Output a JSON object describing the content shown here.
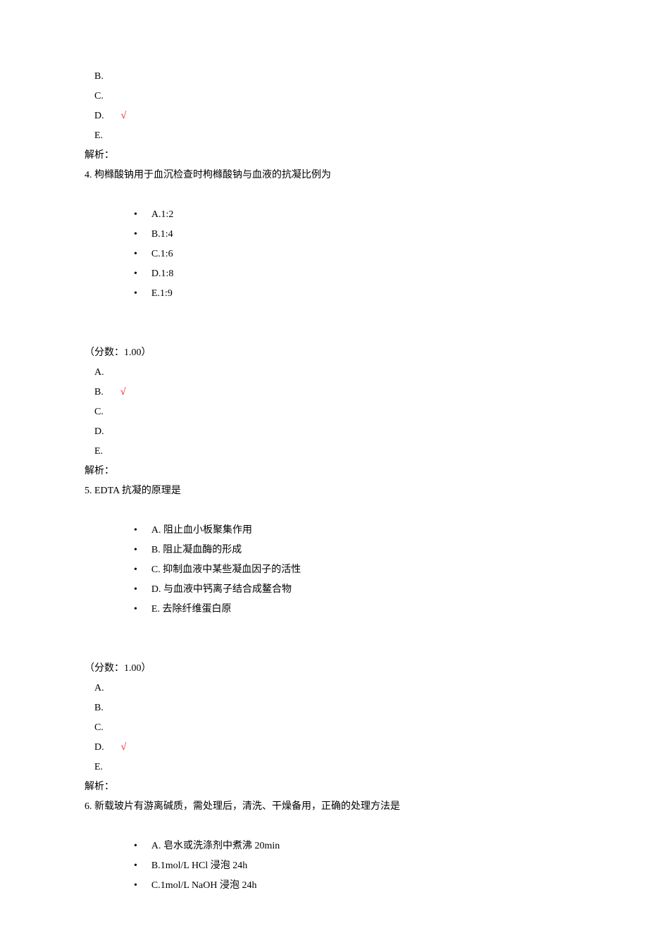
{
  "q3_tail": {
    "answers": {
      "b": "B.",
      "c": "C.",
      "d": "D.",
      "e": "E."
    },
    "check": "√",
    "jiexi": "解析："
  },
  "q4": {
    "stem": "4. 枸橼酸钠用于血沉检查时枸橼酸钠与血液的抗凝比例为",
    "opts": {
      "a": "A.1:2",
      "b": "B.1:4",
      "c": "C.1:6",
      "d": "D.1:8",
      "e": "E.1:9"
    },
    "score": "（分数：1.00）",
    "answers": {
      "a": "A.",
      "b": "B.",
      "c": "C.",
      "d": "D.",
      "e": "E."
    },
    "check": "√",
    "jiexi": "解析："
  },
  "q5": {
    "stem": "5.   EDTA 抗凝的原理是",
    "opts": {
      "a": "A. 阻止血小板聚集作用",
      "b": "B. 阻止凝血酶的形成",
      "c": "C. 抑制血液中某些凝血因子的活性",
      "d": "D. 与血液中钙离子结合成鳌合物",
      "e": "E. 去除纤维蛋白原"
    },
    "score": "（分数：1.00）",
    "answers": {
      "a": "A.",
      "b": "B.",
      "c": "C.",
      "d": "D.",
      "e": "E."
    },
    "check": "√",
    "jiexi": "解析："
  },
  "q6": {
    "stem": "6. 新载玻片有游离碱质，需处理后，清洗、干燥备用，正确的处理方法是",
    "opts": {
      "a": "A. 皂水或洗涤剂中煮沸 20min",
      "b": "B.1mol/L  HCl 浸泡 24h",
      "c": "C.1mol/L  NaOH 浸泡 24h"
    }
  }
}
